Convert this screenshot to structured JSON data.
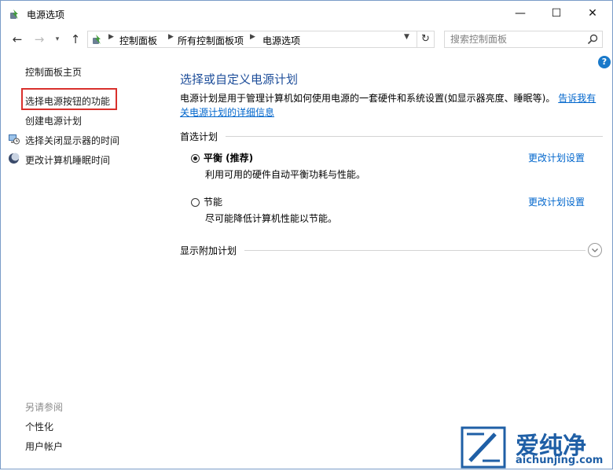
{
  "window": {
    "title": "电源选项",
    "minimize_glyph": "—",
    "maximize_glyph": "☐",
    "close_glyph": "✕"
  },
  "nav": {
    "back_glyph": "←",
    "forward_glyph": "→",
    "recent_glyph": "▾",
    "up_glyph": "↑",
    "refresh_glyph": "↻"
  },
  "breadcrumb": [
    "控制面板",
    "所有控制面板项",
    "电源选项"
  ],
  "search": {
    "placeholder": "搜索控制面板"
  },
  "sidebar": {
    "home": "控制面板主页",
    "items": [
      {
        "label": "选择电源按钮的功能",
        "icon": "none",
        "highlighted": true
      },
      {
        "label": "创建电源计划",
        "icon": "none"
      },
      {
        "label": "选择关闭显示器的时间",
        "icon": "monitor-clock-icon"
      },
      {
        "label": "更改计算机睡眠时间",
        "icon": "moon-icon"
      }
    ],
    "see_also": {
      "heading": "另请参阅",
      "links": [
        "个性化",
        "用户帐户"
      ]
    }
  },
  "help_label": "?",
  "main": {
    "title": "选择或自定义电源计划",
    "description": "电源计划是用于管理计算机如何使用电源的一套硬件和系统设置(如显示器亮度、睡眠等)。",
    "description_link": "告诉我有关电源计划的详细信息",
    "preferred_heading": "首选计划",
    "plans": [
      {
        "name": "平衡 (推荐)",
        "description": "利用可用的硬件自动平衡功耗与性能。",
        "selected": true,
        "action": "更改计划设置"
      },
      {
        "name": "节能",
        "description": "尽可能降低计算机性能以节能。",
        "selected": false,
        "action": "更改计划设置"
      }
    ],
    "additional_heading": "显示附加计划"
  },
  "watermark": {
    "brand": "爱纯净",
    "url": "aichunjing.com"
  },
  "colors": {
    "link": "#0066cc",
    "title": "#1e4e9a",
    "highlight_border": "#d9302c",
    "accent": "#1979ca"
  }
}
